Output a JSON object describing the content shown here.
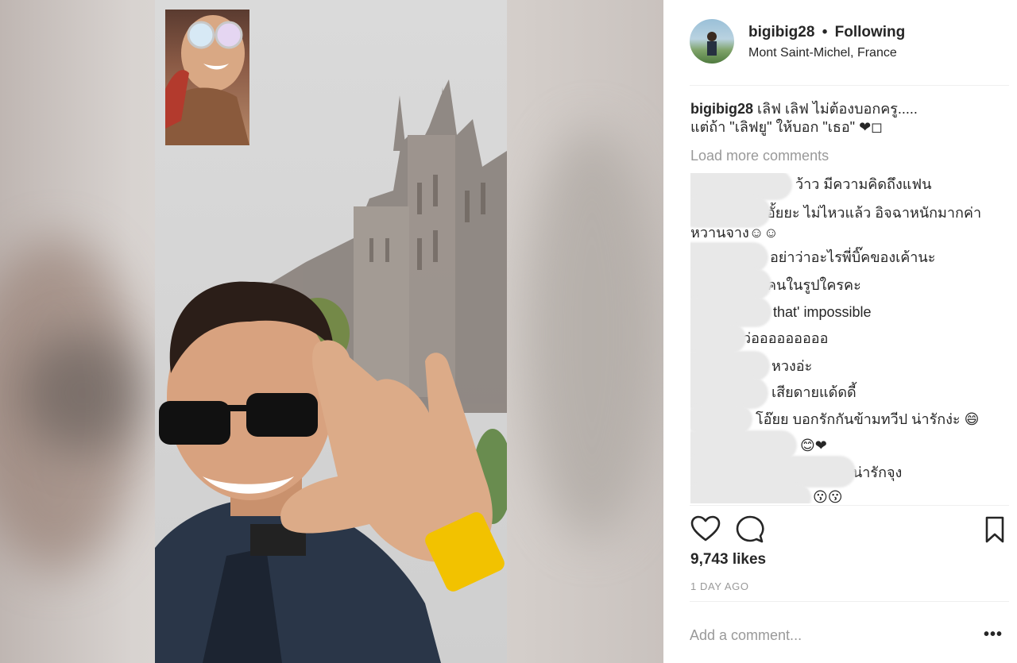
{
  "post": {
    "username": "bigibig28",
    "separator": "•",
    "follow_status": "Following",
    "location": "Mont Saint-Michel, France",
    "caption_user": "bigibig28",
    "caption_line1": " เลิฟ เลิฟ ไม่ต้องบอกครู.....",
    "caption_line2": "แต่ถ้า \"เลิฟยู\" ให้บอก \"เธอ\" ❤◻"
  },
  "comments": {
    "load_more": "Load more comments",
    "items": [
      {
        "text": "ว้าว มีความคิดถึงแฟน"
      },
      {
        "text": "อั้ยยะ ไม่ไหวแล้ว อิจฉาหนักมากค่า"
      },
      {
        "text": "หวานจาง☺☺"
      },
      {
        "text": "อย่าว่าอะไรพี่บิ๊คของเค้านะ"
      },
      {
        "text": "คนในรูปใครคะ"
      },
      {
        "text": "that' impossible"
      },
      {
        "text": "ว่อออออออออ"
      },
      {
        "text": "หวงอ่ะ"
      },
      {
        "text": "เสียดายแด้ดดี้"
      },
      {
        "text": "โอ๊ยย บอกรักกันข้ามทวีป น่ารักง่ะ 😄"
      },
      {
        "text": "😊❤"
      },
      {
        "text": "น่ารักจุง"
      },
      {
        "text": "😗😗"
      }
    ]
  },
  "actions": {
    "like_icon": "heart-outline-icon",
    "comment_icon": "comment-bubble-icon",
    "save_icon": "bookmark-icon"
  },
  "likes": "9,743 likes",
  "time_ago": "1 DAY AGO",
  "comment_box": {
    "placeholder": "Add a comment...",
    "more": "•••"
  },
  "colors": {
    "text": "#262626",
    "muted": "#999999",
    "divider": "#efefef"
  }
}
